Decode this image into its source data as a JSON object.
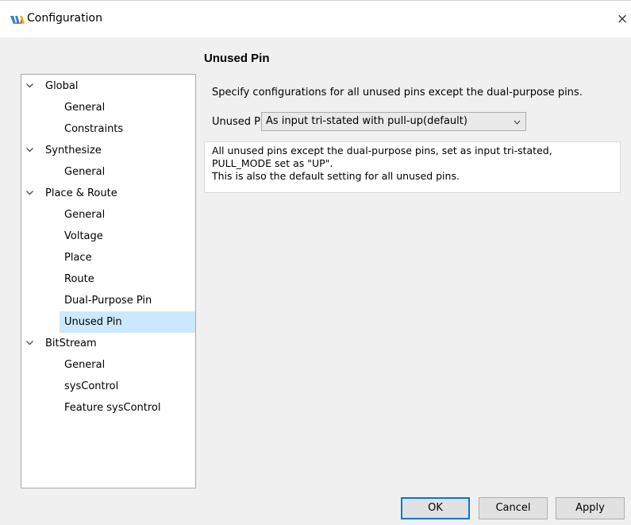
{
  "window": {
    "title": "Configuration",
    "close_glyph": "×",
    "icon": "gowin-logo-icon"
  },
  "tree": [
    {
      "label": "Global",
      "level": 0,
      "expanded": true,
      "selected": false
    },
    {
      "label": "General",
      "level": 1,
      "selected": false
    },
    {
      "label": "Constraints",
      "level": 1,
      "selected": false
    },
    {
      "label": "Synthesize",
      "level": 0,
      "expanded": true,
      "selected": false
    },
    {
      "label": "General",
      "level": 1,
      "selected": false
    },
    {
      "label": "Place & Route",
      "level": 0,
      "expanded": true,
      "selected": false
    },
    {
      "label": "General",
      "level": 1,
      "selected": false
    },
    {
      "label": "Voltage",
      "level": 1,
      "selected": false
    },
    {
      "label": "Place",
      "level": 1,
      "selected": false
    },
    {
      "label": "Route",
      "level": 1,
      "selected": false
    },
    {
      "label": "Dual-Purpose Pin",
      "level": 1,
      "selected": false
    },
    {
      "label": "Unused Pin",
      "level": 1,
      "selected": true
    },
    {
      "label": "BitStream",
      "level": 0,
      "expanded": true,
      "selected": false
    },
    {
      "label": "General",
      "level": 1,
      "selected": false
    },
    {
      "label": "sysControl",
      "level": 1,
      "selected": false
    },
    {
      "label": "Feature sysControl",
      "level": 1,
      "selected": false
    }
  ],
  "panel": {
    "title": "Unused Pin",
    "description": "Specify configurations for all unused pins except the dual-purpose pins.",
    "field_label": "Unused Pin:",
    "field_value": "As input tri-stated with pull-up(default)",
    "info_lines": [
      "All unused pins except the dual-purpose pins, set as input tri-stated,",
      "PULL_MODE set as \"UP\".",
      "This is also the default setting for all unused pins."
    ]
  },
  "buttons": {
    "ok": "OK",
    "cancel": "Cancel",
    "apply": "Apply"
  },
  "colors": {
    "selection": "#cce8ff",
    "default_button_border": "#0078d7",
    "background": "#f0f0f0"
  }
}
